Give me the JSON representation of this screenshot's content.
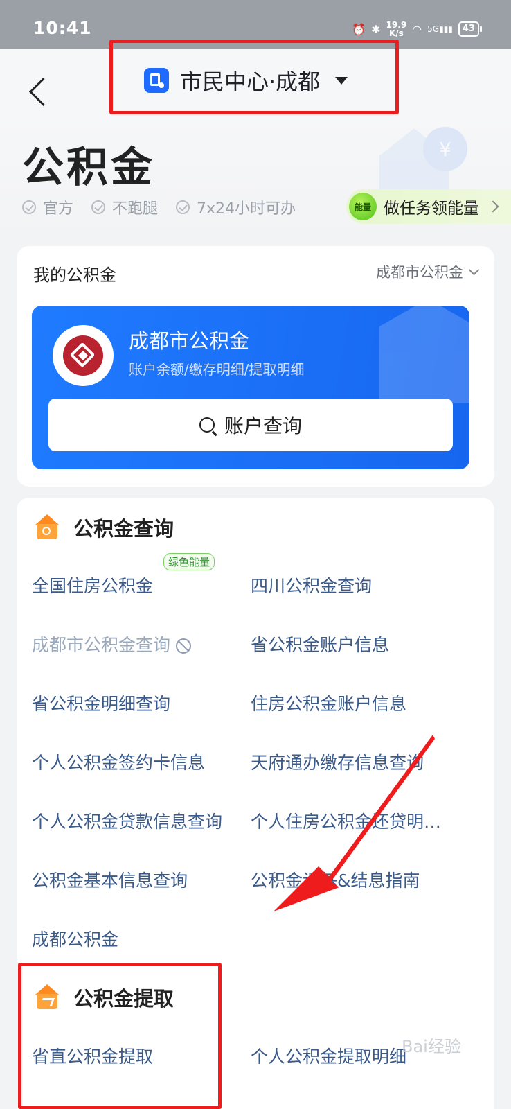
{
  "status_bar": {
    "time": "10:41",
    "speed_value": "19.9",
    "speed_unit": "K/s",
    "network": "5G",
    "battery": "43"
  },
  "nav": {
    "title": "市民中心·成都"
  },
  "header": {
    "title": "公积金",
    "tags": [
      "官方",
      "不跑腿",
      "7x24小时可办"
    ],
    "energy_task": {
      "badge": "能量",
      "label": "做任务领能量"
    }
  },
  "my_fund": {
    "title": "我的公积金",
    "city_select": "成都市公积金",
    "card": {
      "name": "成都市公积金",
      "subtitle": "账户余额/缴存明细/提取明细",
      "button": "账户查询"
    }
  },
  "query_section": {
    "title": "公积金查询",
    "items": [
      {
        "label": "全国住房公积金",
        "badge": "绿色能量"
      },
      {
        "label": "四川公积金查询"
      },
      {
        "label": "成都市公积金查询",
        "disabled": true
      },
      {
        "label": "省公积金账户信息"
      },
      {
        "label": "省公积金明细查询"
      },
      {
        "label": "住房公积金账户信息"
      },
      {
        "label": "个人公积金签约卡信息"
      },
      {
        "label": "天府通办缴存信息查询"
      },
      {
        "label": "个人公积金贷款信息查询"
      },
      {
        "label": "个人住房公积金还贷明…"
      },
      {
        "label": "公积金基本信息查询"
      },
      {
        "label": "公积金调基&结息指南"
      },
      {
        "label": "成都公积金"
      }
    ]
  },
  "withdraw_section": {
    "title": "公积金提取",
    "items": [
      {
        "label": "省直公积金提取"
      },
      {
        "label": "个人公积金提取明细"
      }
    ]
  },
  "watermark": "Bai经验",
  "colors": {
    "accent": "#1f7bff",
    "link": "#3a5a8a",
    "highlight": "#ee1c1c",
    "section_icon": "#ff8a1f"
  }
}
